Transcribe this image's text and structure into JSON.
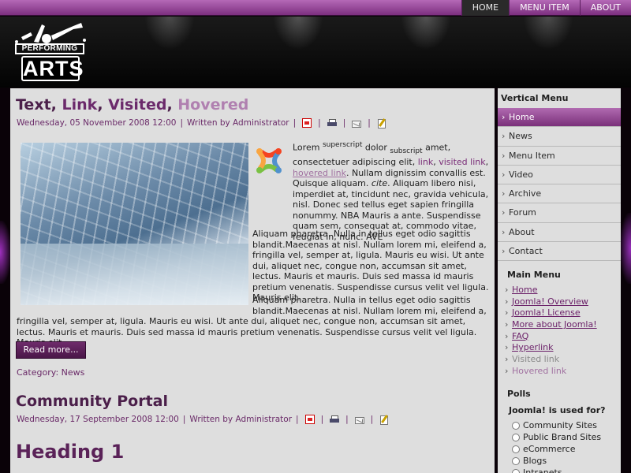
{
  "topnav": {
    "items": [
      "HOME",
      "MENU ITEM",
      "ABOUT"
    ],
    "active": 0
  },
  "logo": {
    "line1": "PERFORMING",
    "line2": "ARTS"
  },
  "article1": {
    "title_parts": [
      "Text",
      ", ",
      "Link",
      ", ",
      "Visited",
      ", ",
      "Hovered"
    ],
    "date": "Wednesday, 05 November 2008 12:00",
    "author": "Written by Administrator",
    "p1": {
      "lorem": "Lorem ",
      "superscript": "superscript",
      "dolor": " dolor ",
      "subscript": "subscript",
      "amet": " amet, consectetuer adipiscing elit, ",
      "link": "link",
      "comma": ", ",
      "visited_link": "visited link",
      "comma2": ", ",
      "hovered_link": "hovered link",
      "rest1": ". Nullam dignissim convallis est. Quisque aliquam. ",
      "cite": "cite",
      "rest2": ". Aliquam libero nisi, imperdiet at, tincidunt nec, gravida vehicula, nisl. Donec sed tellus eget sapien fringilla nonummy. NBA Mauris a ante. Suspendisse quam sem, consequat at, commodo vitae, feugiat in, nunc. AVE"
    },
    "p2": "Aliquam pharetra. Nulla in tellus eget odio sagittis blandit.Maecenas at nisl. Nullam lorem mi, eleifend a, fringilla vel, semper at, ligula. Mauris eu wisi. Ut ante dui, aliquet nec, congue non, accumsan sit amet, lectus. Mauris et mauris. Duis sed massa id mauris pretium venenatis. Suspendisse cursus velit vel ligula. Mauris elit.",
    "p3_a": "Aliquam pharetra. Nulla in tellus eget odio sagittis blandit.Maecenas at nisl. Nullam lorem mi, eleifend a,",
    "p3_b": "fringilla vel, semper at, ligula. Mauris eu wisi. Ut ante dui, aliquet nec, congue non, accumsan sit amet, lectus. Mauris et mauris. Duis sed massa id mauris pretium venenatis. Suspendisse cursus velit vel ligula. Mauris elit.",
    "readmore": "Read more...",
    "category_label": "Category: ",
    "category": "News"
  },
  "article2": {
    "title": "Community Portal",
    "date": "Wednesday, 17 September 2008 12:00",
    "author": "Written by Administrator"
  },
  "heading1": "Heading 1",
  "sidebar": {
    "vmenu_title": "Vertical Menu",
    "vmenu": [
      "Home",
      "News",
      "Menu Item",
      "Video",
      "Archive",
      "Forum",
      "About",
      "Contact"
    ],
    "mainmenu_title": "Main Menu",
    "mainmenu": [
      "Home",
      "Joomla! Overview",
      "Joomla! License",
      "More about Joomla!",
      "FAQ",
      "Hyperlink",
      "Visited link",
      "Hovered link"
    ],
    "polls_title": "Polls",
    "poll_question": "Joomla! is used for?",
    "poll_options": [
      "Community Sites",
      "Public Brand Sites",
      "eCommerce",
      "Blogs",
      "Intranets"
    ]
  },
  "colors": {
    "accent": "#7a2d78",
    "menu_active": "#9a4c9a",
    "content_bg": "#dedede"
  }
}
